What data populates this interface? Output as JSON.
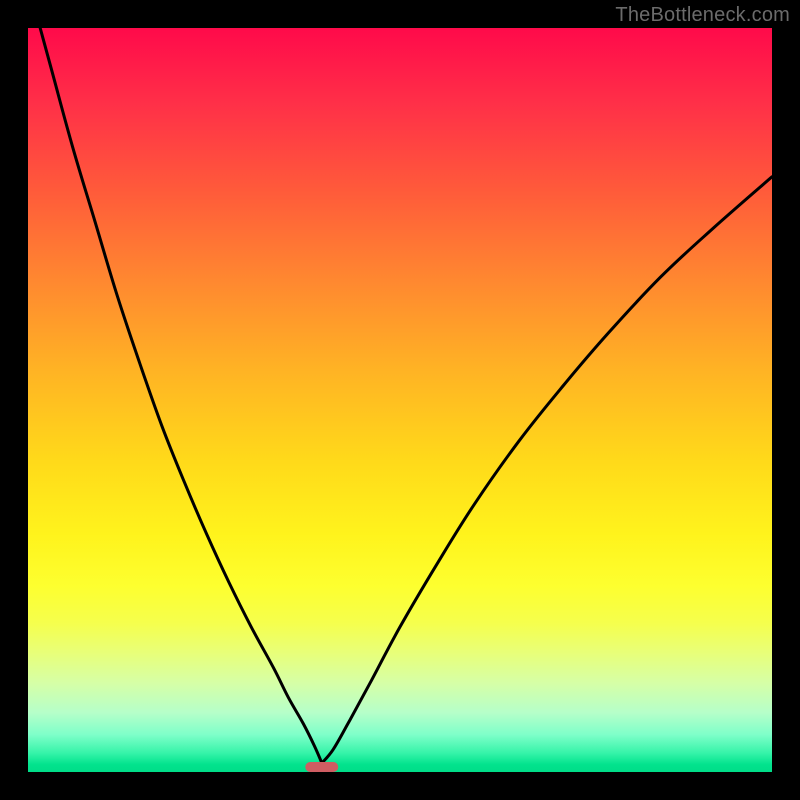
{
  "watermark": "TheBottleneck.com",
  "colors": {
    "background": "#000000",
    "curve": "#000000",
    "marker": "#cf5d62",
    "gradient_top": "#ff0a4a",
    "gradient_bottom": "#00dd88"
  },
  "chart_data": {
    "type": "line",
    "title": "",
    "xlabel": "",
    "ylabel": "",
    "xlim": [
      0,
      100
    ],
    "ylim": [
      0,
      100
    ],
    "grid": false,
    "annotations": [
      {
        "name": "marker",
        "x": 39.5,
        "y": 0.7,
        "w": 4.5,
        "h": 1.4
      }
    ],
    "series": [
      {
        "name": "left-branch",
        "x": [
          0,
          3,
          6,
          9,
          12,
          15,
          18,
          21,
          24,
          27,
          30,
          33,
          35,
          37,
          38.5,
          39.5
        ],
        "y": [
          106,
          95,
          84,
          74,
          64,
          55,
          46.5,
          39,
          32,
          25.5,
          19.5,
          14,
          10,
          6.5,
          3.5,
          1.2
        ]
      },
      {
        "name": "right-branch",
        "x": [
          39.5,
          41,
          43,
          46,
          50,
          55,
          60,
          66,
          72,
          78,
          85,
          92,
          100
        ],
        "y": [
          1.2,
          3,
          6.5,
          12,
          19.5,
          28,
          36,
          44.5,
          52,
          59,
          66.5,
          73,
          80
        ]
      }
    ]
  }
}
